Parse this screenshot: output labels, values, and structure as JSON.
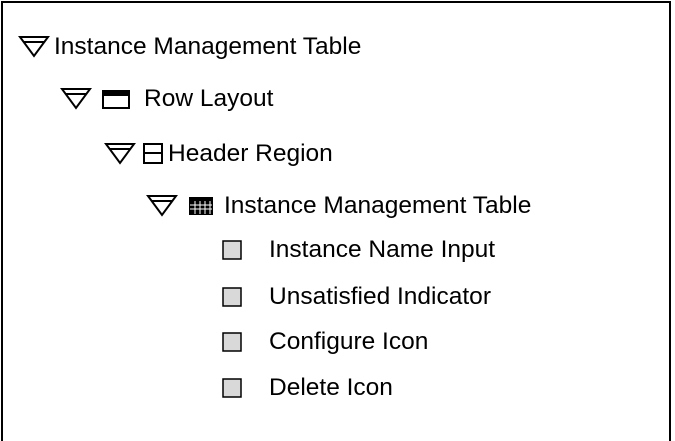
{
  "tree": {
    "root": {
      "label": "Instance Management Table",
      "expanded": true,
      "icon": "triangle-down-icon",
      "children": [
        {
          "label": "Row Layout",
          "expanded": true,
          "icon": "row-layout-icon",
          "children": [
            {
              "label": "Header Region",
              "expanded": true,
              "icon": "header-region-icon",
              "children": [
                {
                  "label": "Instance Management Table",
                  "expanded": true,
                  "icon": "table-grid-icon",
                  "children": [
                    {
                      "label": "Instance Name Input",
                      "icon": "item-square-icon"
                    },
                    {
                      "label": "Unsatisfied Indicator",
                      "icon": "item-square-icon"
                    },
                    {
                      "label": "Configure Icon",
                      "icon": "item-square-icon"
                    },
                    {
                      "label": "Delete Icon",
                      "icon": "item-square-icon"
                    }
                  ]
                }
              ]
            }
          ]
        }
      ]
    }
  },
  "colors": {
    "text": "#000000",
    "item_fill": "#d9d9d9",
    "grid_fill": "#000000"
  }
}
